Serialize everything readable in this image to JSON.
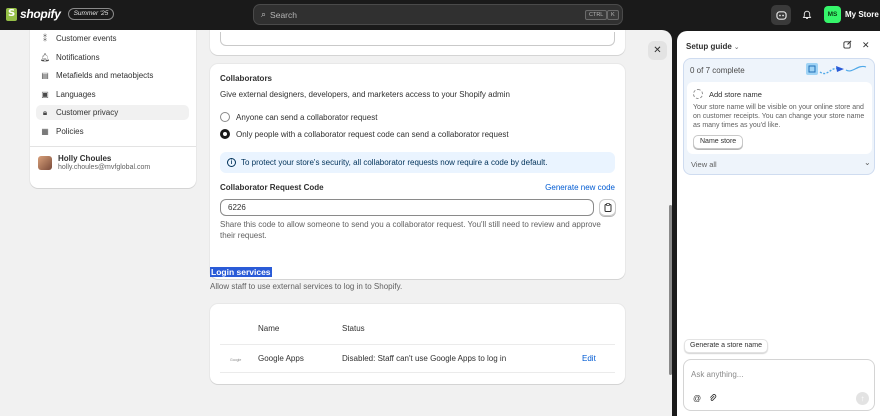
{
  "topbar": {
    "brand": "shopify",
    "edition": "Summer '25",
    "search_placeholder": "Search",
    "kbd_ctrl": "CTRL",
    "kbd_k": "K",
    "store_initials": "MS",
    "store_name": "My Store"
  },
  "nav": {
    "items": [
      {
        "label": "Customer events",
        "icon": "events-icon"
      },
      {
        "label": "Notifications",
        "icon": "bell-icon"
      },
      {
        "label": "Metafields and metaobjects",
        "icon": "database-icon"
      },
      {
        "label": "Languages",
        "icon": "language-icon"
      },
      {
        "label": "Customer privacy",
        "icon": "lock-icon",
        "active": true
      },
      {
        "label": "Policies",
        "icon": "policy-icon"
      }
    ],
    "user": {
      "name": "Holly Choules",
      "email": "holly.choules@mvfglobal.com"
    }
  },
  "collaborators": {
    "title": "Collaborators",
    "description": "Give external designers, developers, and marketers access to your Shopify admin",
    "options": [
      {
        "label": "Anyone can send a collaborator request",
        "selected": false
      },
      {
        "label": "Only people with a collaborator request code can send a collaborator request",
        "selected": true
      }
    ],
    "banner": "To protect your store's security, all collaborator requests now require a code by default.",
    "code_label": "Collaborator Request Code",
    "generate_link": "Generate new code",
    "code_value": "6226",
    "help_text": "Share this code to allow someone to send you a collaborator request. You'll still need to review and approve their request."
  },
  "login": {
    "title": "Login services",
    "description": "Allow staff to use external services to log in to Shopify.",
    "columns": [
      "Name",
      "Status"
    ],
    "rows": [
      {
        "logo": "Google",
        "name": "Google Apps",
        "status": "Disabled: Staff can't use Google Apps to log in",
        "action": "Edit"
      }
    ]
  },
  "setup_guide": {
    "title": "Setup guide",
    "progress": "0 of 7 complete",
    "task_title": "Add store name",
    "task_desc": "Your store name will be visible on your online store and on customer receipts. You can change your store name as many times as you'd like.",
    "task_button": "Name store",
    "view_all": "View all",
    "suggestion": "Generate a store name",
    "ask_placeholder": "Ask anything..."
  },
  "colors": {
    "accent": "#005bd3",
    "store_avatar": "#36f56b",
    "brand_green": "#95bf47"
  }
}
